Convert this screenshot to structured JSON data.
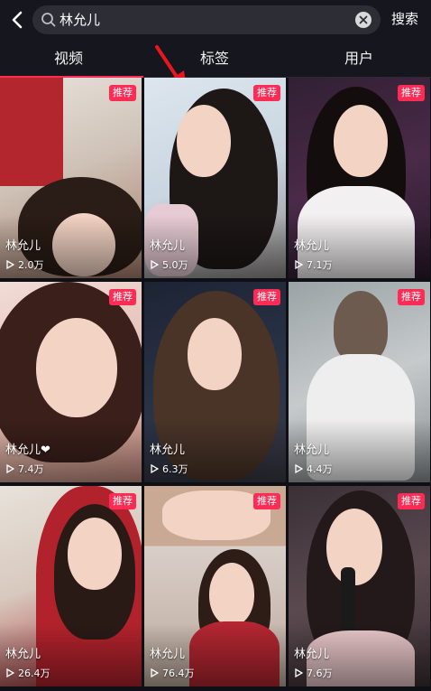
{
  "search": {
    "query": "林允儿",
    "submit_label": "搜索"
  },
  "tabs": [
    {
      "label": "视频"
    },
    {
      "label": "标签"
    },
    {
      "label": "用户"
    }
  ],
  "colors": {
    "accent": "#fe2c55",
    "background": "#0f1016",
    "bar": "#16161e"
  },
  "icons": [
    "back-arrow-icon",
    "search-icon",
    "clear-icon",
    "play-icon",
    "red-pointer-arrow"
  ],
  "videos": [
    {
      "caption": "林允儿",
      "views": "2.0万",
      "badge": "推荐"
    },
    {
      "caption": "林允儿",
      "views": "5.0万",
      "badge": "推荐"
    },
    {
      "caption": "林允儿",
      "views": "7.1万",
      "badge": "推荐"
    },
    {
      "caption": "林允儿❤",
      "views": "7.4万",
      "badge": "推荐"
    },
    {
      "caption": "林允儿",
      "views": "6.3万",
      "badge": "推荐"
    },
    {
      "caption": "林允儿",
      "views": "4.4万",
      "badge": "推荐"
    },
    {
      "caption": "林允儿",
      "views": "26.4万",
      "badge": "推荐"
    },
    {
      "caption": "林允儿",
      "views": "76.4万",
      "badge": "推荐"
    },
    {
      "caption": "林允儿",
      "views": "7.6万",
      "badge": "推荐"
    }
  ]
}
